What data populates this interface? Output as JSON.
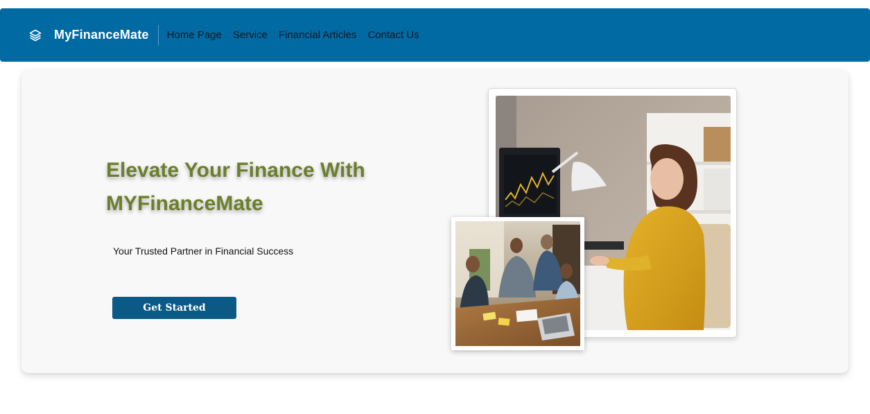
{
  "app": {
    "brand": "MyFinanceMate",
    "brand_icon": "layers-icon"
  },
  "nav": {
    "items": [
      {
        "label": "Home Page"
      },
      {
        "label": "Service"
      },
      {
        "label": "Financial Articles"
      },
      {
        "label": "Contact Us"
      }
    ]
  },
  "hero": {
    "title": "Elevate Your Finance With MYFinanceMate",
    "subtitle": "Your Trusted Partner in Financial Success",
    "cta_label": "Get Started"
  },
  "images": {
    "large": "woman-at-desk-with-stock-chart-photo",
    "small": "team-meeting-around-table-photo"
  },
  "colors": {
    "navbar": "#026aa2",
    "title": "#6b7f2b",
    "button": "#0b5a85",
    "card": "#f8f8f8"
  }
}
